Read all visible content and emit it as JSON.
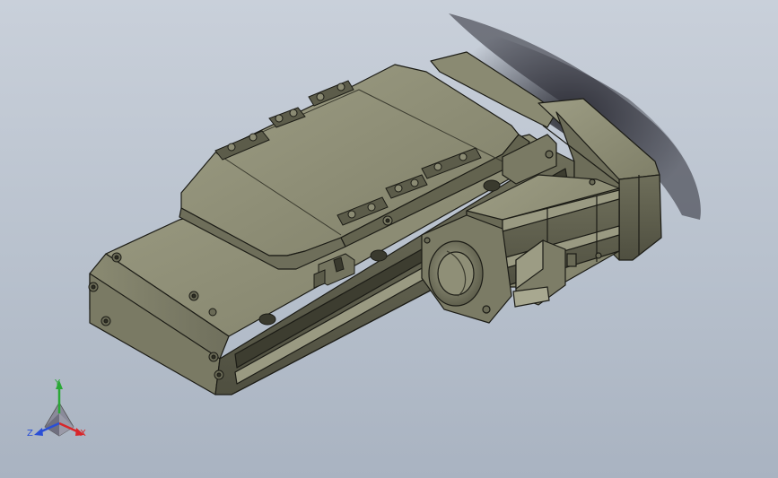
{
  "viewport": {
    "background_top": "#c9d0da",
    "background_bottom": "#a9b3c1"
  },
  "model": {
    "body_color": "#8c8c74",
    "dark_color": "#4a4a3c",
    "edge_color": "#1c1c16",
    "light_color": "#b5b59c"
  },
  "triad": {
    "x_label": "X",
    "y_label": "Y",
    "z_label": "Z",
    "x_color": "#d8262a",
    "y_color": "#2aa836",
    "z_color": "#2a4fd6"
  }
}
